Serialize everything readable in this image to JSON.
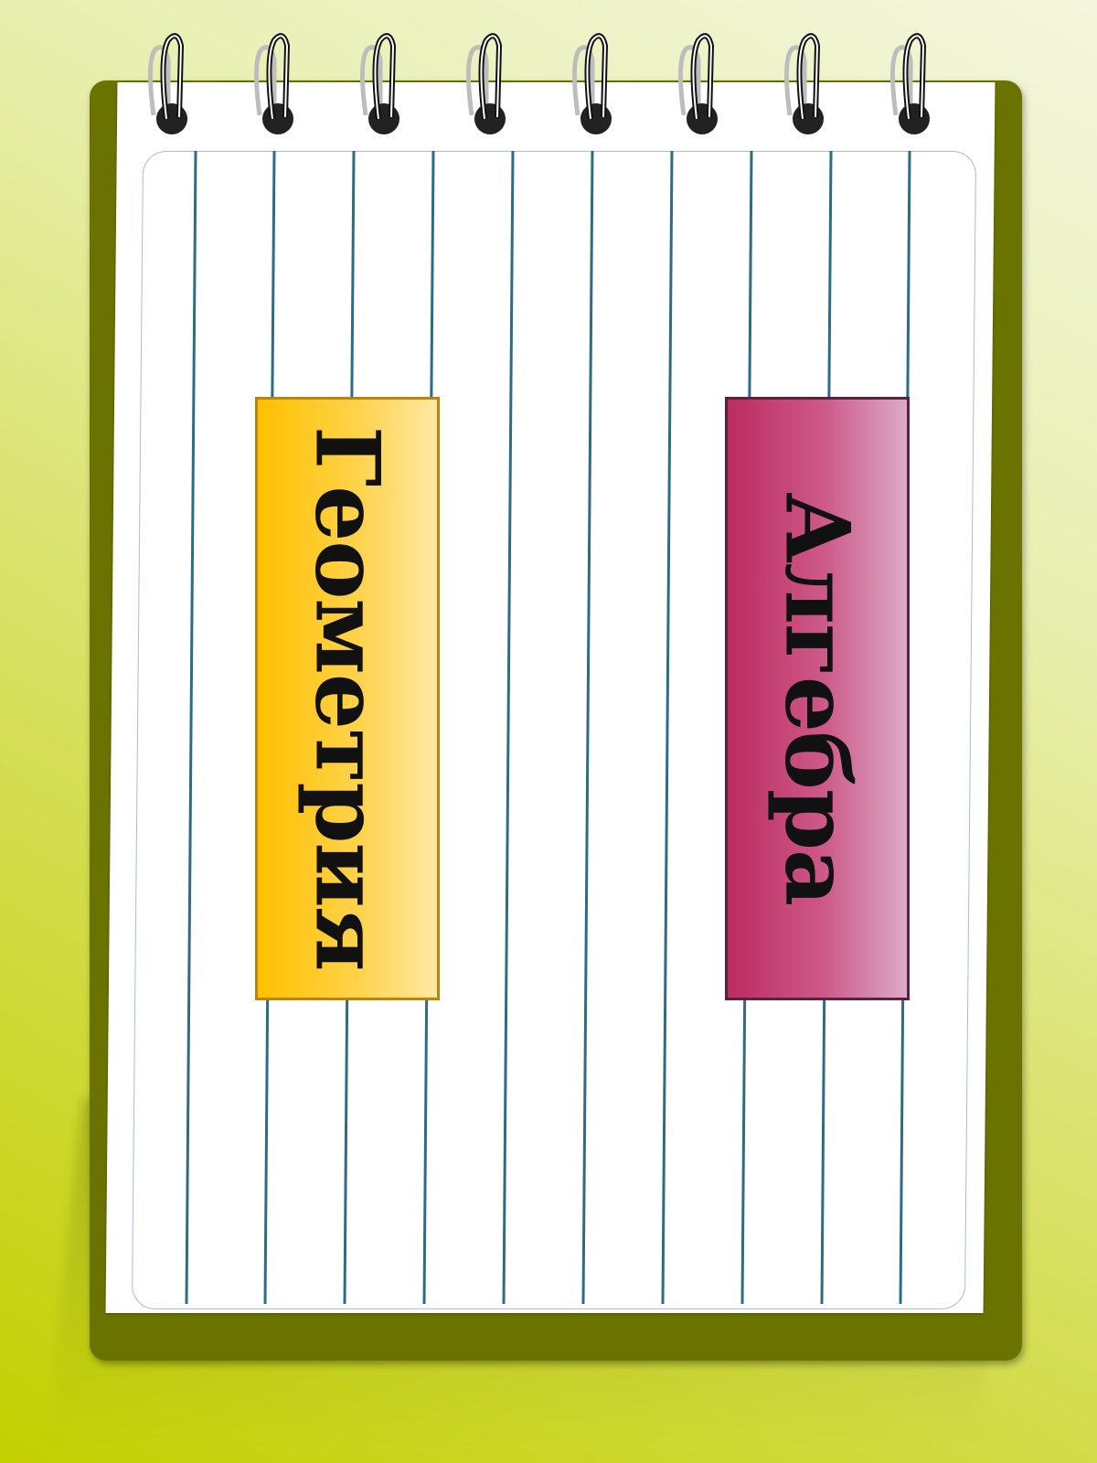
{
  "labels": {
    "geometry": "Геометрия",
    "algebra": "Алгебра"
  },
  "colors": {
    "background": "#d5de55",
    "cover": "#6b7300",
    "paper": "#ffffff",
    "ruled_line": "#2e6b85",
    "geometry_tab": "#ffc000",
    "algebra_tab": "#bc2c60"
  }
}
